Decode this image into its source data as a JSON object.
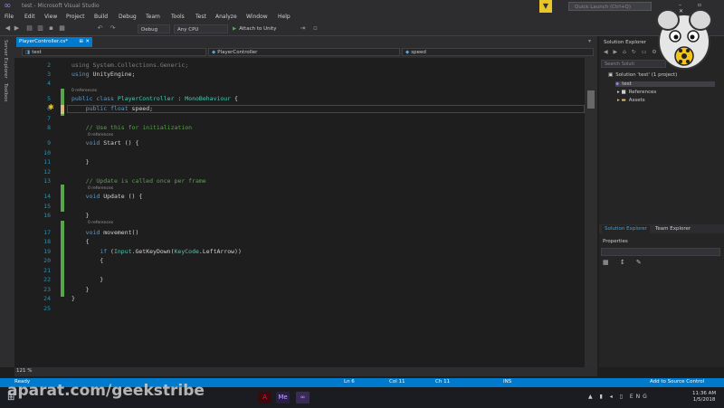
{
  "window": {
    "title": "test - Microsoft Visual Studio",
    "quick_launch_placeholder": "Quick Launch (Ctrl+Q)",
    "controls": "– ▫ ✕"
  },
  "menu": [
    "File",
    "Edit",
    "View",
    "Project",
    "Build",
    "Debug",
    "Team",
    "Tools",
    "Test",
    "Analyze",
    "Window",
    "Help"
  ],
  "toolbar": {
    "config": "Debug",
    "platform": "Any CPU",
    "attach": "Attach to Unity"
  },
  "side_tabs": [
    "Server Explorer",
    "Toolbox"
  ],
  "document_tab": {
    "label": "PlayerController.cs*",
    "pin": "⊞",
    "close": "✕"
  },
  "navbar": {
    "project": "test",
    "class": "PlayerController",
    "member": "speed"
  },
  "code_lines": [
    {
      "n": "2",
      "text": "using System.Collections.Generic;"
    },
    {
      "n": "3",
      "text": "using UnityEngine;"
    },
    {
      "n": "4",
      "text": ""
    },
    {
      "n": "",
      "refs": "0 references"
    },
    {
      "n": "5",
      "text": "public class PlayerController : MonoBehaviour {"
    },
    {
      "n": "6",
      "text": "    public float speed;"
    },
    {
      "n": "7",
      "text": ""
    },
    {
      "n": "8",
      "text": "    // Use this for initialization"
    },
    {
      "n": "",
      "refs": "0 references"
    },
    {
      "n": "9",
      "text": "    void Start () {"
    },
    {
      "n": "10",
      "text": ""
    },
    {
      "n": "11",
      "text": "    }"
    },
    {
      "n": "12",
      "text": ""
    },
    {
      "n": "13",
      "text": "    // Update is called once per frame"
    },
    {
      "n": "",
      "refs": "0 references"
    },
    {
      "n": "14",
      "text": "    void Update () {"
    },
    {
      "n": "15",
      "text": ""
    },
    {
      "n": "16",
      "text": "    }"
    },
    {
      "n": "",
      "refs": "0 references"
    },
    {
      "n": "17",
      "text": "    void movement()"
    },
    {
      "n": "18",
      "text": "    {"
    },
    {
      "n": "19",
      "text": "        if (Input.GetKeyDown(KeyCode.LeftArrow))"
    },
    {
      "n": "20",
      "text": "        {"
    },
    {
      "n": "21",
      "text": ""
    },
    {
      "n": "22",
      "text": "        }"
    },
    {
      "n": "23",
      "text": "    }"
    },
    {
      "n": "24",
      "text": "}"
    },
    {
      "n": "25",
      "text": ""
    }
  ],
  "editor": {
    "zoom": "121 %"
  },
  "solution_explorer": {
    "title": "Solution Explorer",
    "search_placeholder": "Search Soluti",
    "items": [
      {
        "label": "Solution 'test' (1 project)",
        "icon": "▣"
      },
      {
        "label": "test",
        "icon": "◆"
      },
      {
        "label": "References",
        "icon": "▸ ■"
      },
      {
        "label": "Assets",
        "icon": "▸ ▬"
      }
    ],
    "tabs": [
      "Solution Explorer",
      "Team Explorer"
    ]
  },
  "properties": {
    "title": "Properties"
  },
  "status": {
    "left": "Ready",
    "ln": "Ln 6",
    "col": "Col 11",
    "ch": "Ch 11",
    "mode": "INS",
    "source_control": "Add to Source Control"
  },
  "taskbar": {
    "tray": "ENG",
    "time": "11:36 AM",
    "date": "1/5/2018"
  },
  "watermark": "aparat.com/geekstribe",
  "colors": {
    "accent": "#007acc",
    "keyword": "#569cd6",
    "type": "#4ec9b0",
    "comment": "#57a64a"
  }
}
